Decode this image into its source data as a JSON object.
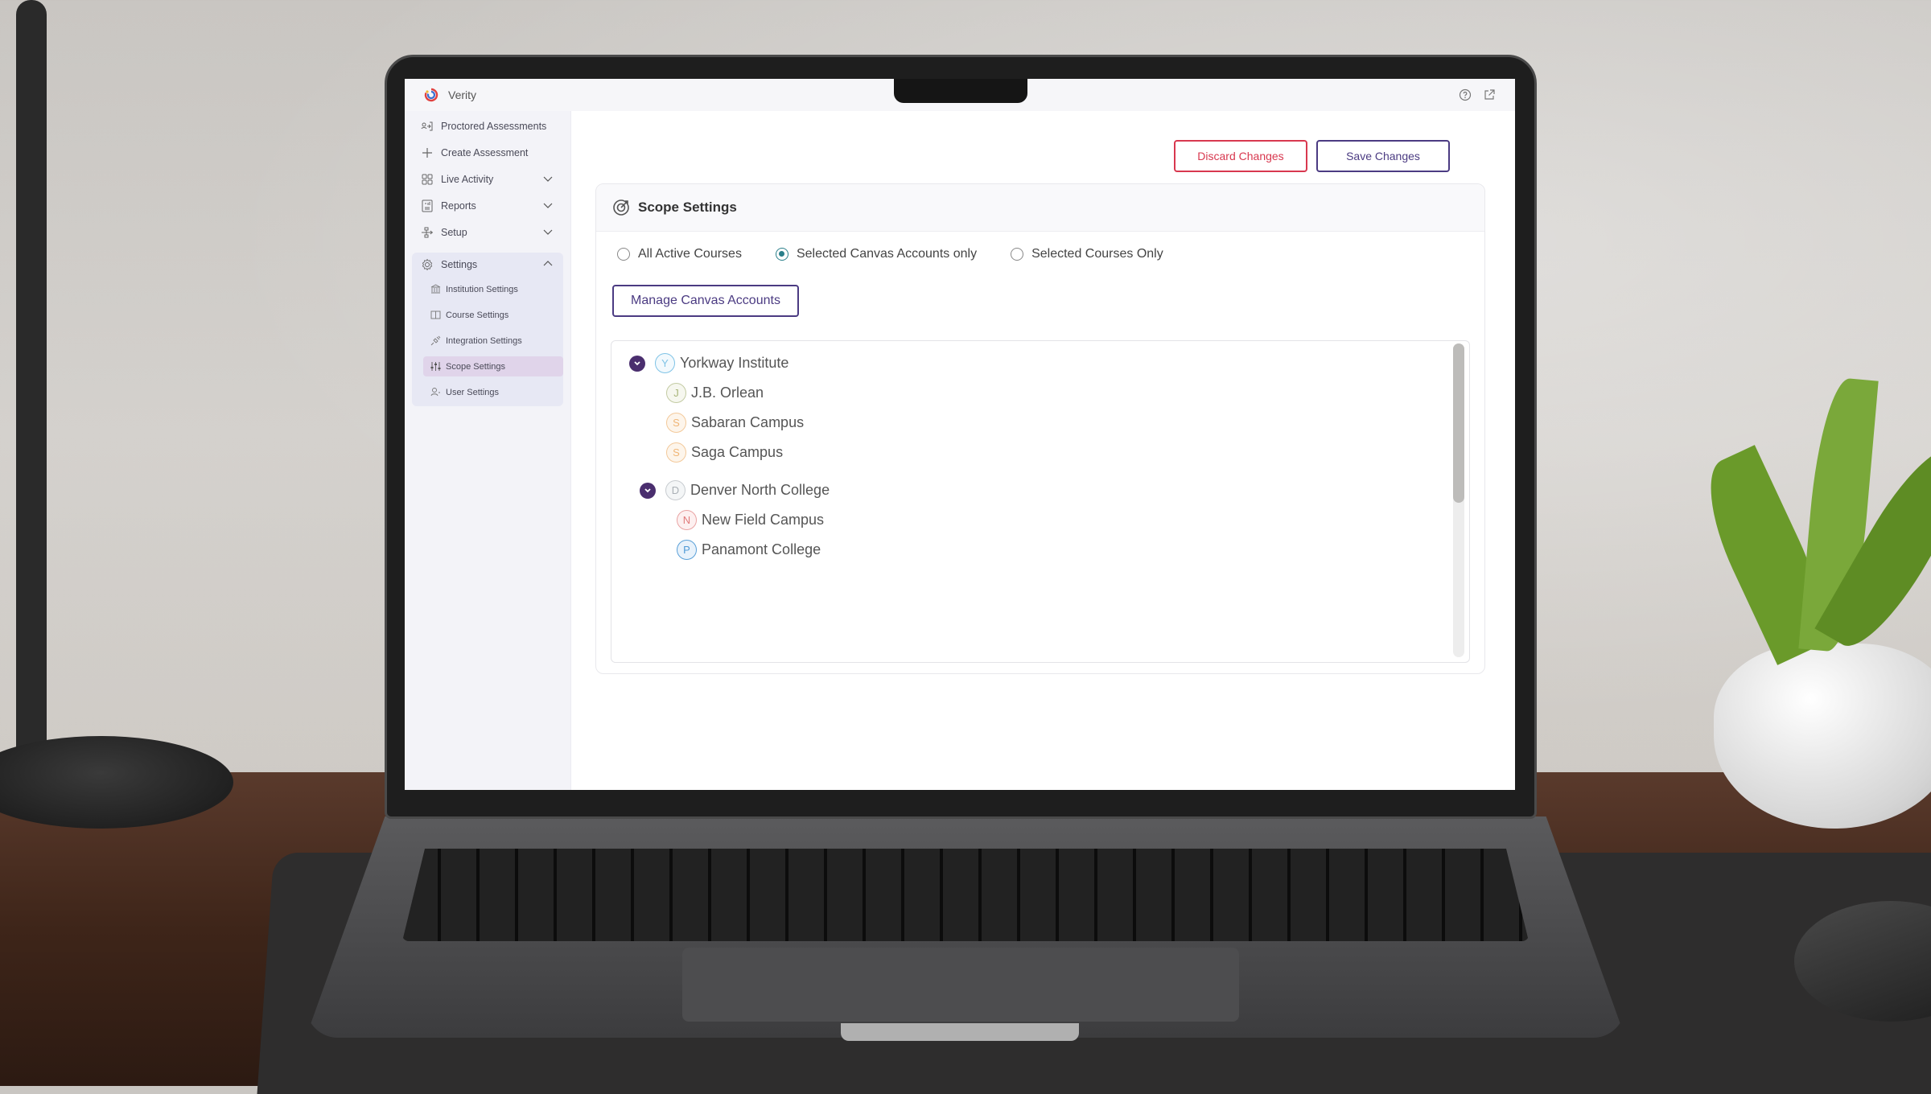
{
  "app": {
    "title": "Verity",
    "help_icon": "help-circle-icon",
    "external_icon": "external-link-icon"
  },
  "sidebar": {
    "items": [
      {
        "label": "Proctored Assessments",
        "icon": "proctor-icon",
        "expandable": false
      },
      {
        "label": "Create Assessment",
        "icon": "plus-icon",
        "expandable": false
      },
      {
        "label": "Live Activity",
        "icon": "grid-icon",
        "expandable": true,
        "expanded": false
      },
      {
        "label": "Reports",
        "icon": "report-icon",
        "expandable": true,
        "expanded": false
      },
      {
        "label": "Setup",
        "icon": "setup-icon",
        "expandable": true,
        "expanded": false
      },
      {
        "label": "Settings",
        "icon": "gear-icon",
        "expandable": true,
        "expanded": true
      }
    ],
    "settings_sub": [
      {
        "label": "Institution Settings",
        "icon": "institution-icon",
        "active": false
      },
      {
        "label": "Course Settings",
        "icon": "book-icon",
        "active": false
      },
      {
        "label": "Integration Settings",
        "icon": "plug-icon",
        "active": false
      },
      {
        "label": "Scope Settings",
        "icon": "sliders-icon",
        "active": true
      },
      {
        "label": "User Settings",
        "icon": "user-icon",
        "active": false
      }
    ]
  },
  "toolbar": {
    "discard_label": "Discard Changes",
    "save_label": "Save Changes"
  },
  "card": {
    "title": "Scope Settings",
    "radios": [
      {
        "label": "All Active Courses",
        "checked": false
      },
      {
        "label": "Selected Canvas Accounts only",
        "checked": true
      },
      {
        "label": "Selected Courses Only",
        "checked": false
      }
    ],
    "manage_label": "Manage Canvas Accounts",
    "tree": [
      {
        "initial": "Y",
        "label": "Yorkway Institute",
        "level": 0,
        "expanded": true,
        "color": "#7fc3e6"
      },
      {
        "initial": "J",
        "label": "J.B. Orlean",
        "level": 1,
        "color": "#a8b57a"
      },
      {
        "initial": "S",
        "label": "Sabaran Campus",
        "level": 1,
        "color": "#f0b677"
      },
      {
        "initial": "S",
        "label": "Saga Campus",
        "level": 1,
        "color": "#f0b677"
      },
      {
        "initial": "D",
        "label": "Denver North College",
        "level": 1,
        "expanded": true,
        "color": "#aab0b6"
      },
      {
        "initial": "N",
        "label": "New Field Campus",
        "level": 2,
        "color": "#e07a7a"
      },
      {
        "initial": "P",
        "label": "Panamont College",
        "level": 2,
        "color": "#4f9ad6"
      }
    ]
  },
  "colors": {
    "accent": "#4b3b82",
    "danger": "#d8384f",
    "radio": "#2a7f8a",
    "toggle": "#4a2e6e",
    "sidebar_active": "#e0d4ea"
  }
}
